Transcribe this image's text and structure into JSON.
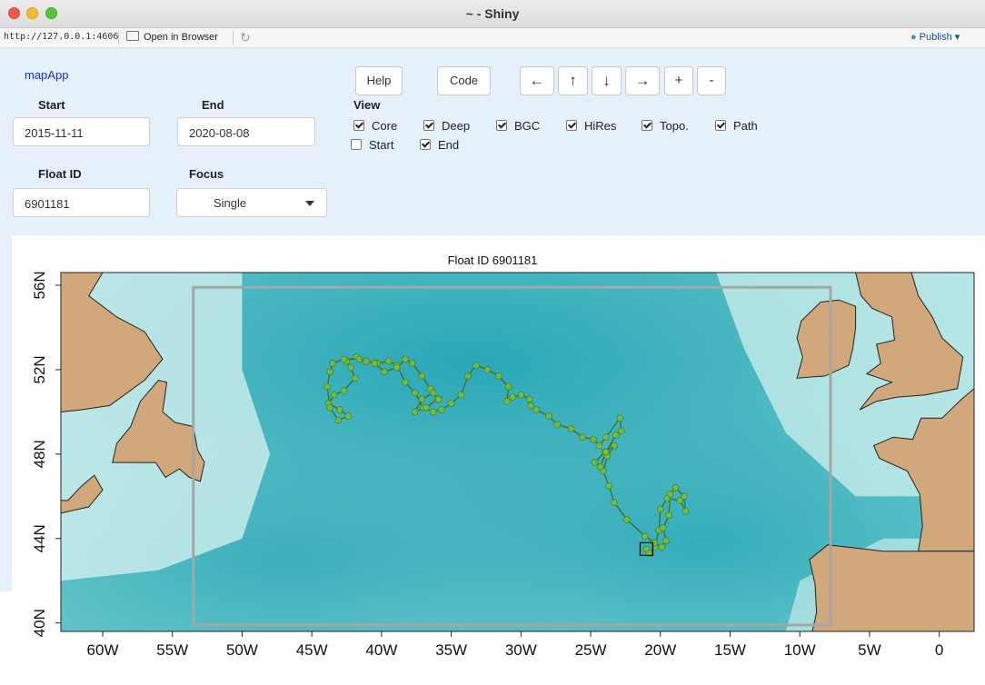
{
  "window": {
    "title": "~ - Shiny"
  },
  "toolbar": {
    "url": "http://127.0.0.1:4606",
    "open_in_browser": "Open in Browser",
    "publish": "Publish"
  },
  "app": {
    "name": "mapApp"
  },
  "form": {
    "start_label": "Start",
    "start_value": "2015-11-11",
    "end_label": "End",
    "end_value": "2020-08-08",
    "float_id_label": "Float ID",
    "float_id_value": "6901181",
    "focus_label": "Focus",
    "focus_value": "Single"
  },
  "buttons": {
    "help": "Help",
    "code": "Code",
    "left": "←",
    "up": "↑",
    "down": "↓",
    "right": "→",
    "zoom_in": "+",
    "zoom_out": "-"
  },
  "view": {
    "label": "View",
    "options": [
      {
        "label": "Core",
        "checked": true
      },
      {
        "label": "Deep",
        "checked": true
      },
      {
        "label": "BGC",
        "checked": true
      },
      {
        "label": "HiRes",
        "checked": true
      },
      {
        "label": "Topo.",
        "checked": true
      },
      {
        "label": "Path",
        "checked": true
      },
      {
        "label": "Start",
        "checked": false
      },
      {
        "label": "End",
        "checked": true
      }
    ]
  },
  "plot": {
    "title": "Float ID 6901181",
    "x_ticks": [
      "60W",
      "55W",
      "50W",
      "45W",
      "40W",
      "35W",
      "30W",
      "25W",
      "20W",
      "15W",
      "10W",
      "5W",
      "0"
    ],
    "y_ticks": [
      "56N",
      "52N",
      "48N",
      "44N",
      "40N"
    ],
    "colors": {
      "ocean_deep": "#3fb0bd",
      "ocean_shallow": "#d9f3f1",
      "land": "#d1a77c",
      "track": "#7cc241",
      "box": "#a6a6a6"
    }
  },
  "chart_data": {
    "type": "scatter",
    "title": "Float ID 6901181",
    "xlabel": "",
    "ylabel": "",
    "xlim": [
      -63,
      2.5
    ],
    "ylim": [
      39.6,
      56.6
    ],
    "x_tick_values": [
      -60,
      -55,
      -50,
      -45,
      -40,
      -35,
      -30,
      -25,
      -20,
      -15,
      -10,
      -5,
      0
    ],
    "y_tick_values": [
      56,
      52,
      48,
      44,
      40
    ],
    "focus_region": {
      "lon": [
        -53.5,
        -7.8
      ],
      "lat": [
        39.9,
        55.9
      ]
    },
    "end_marker": {
      "lon": -21.0,
      "lat": 43.5
    },
    "track": {
      "lon": [
        -21.0,
        -20.8,
        -20.4,
        -20.1,
        -20.0,
        -19.5,
        -18.6,
        -18.2,
        -18.3,
        -18.9,
        -19.3,
        -19.4,
        -19.8,
        -19.6,
        -19.9,
        -20.4,
        -21.1,
        -22.4,
        -23.3,
        -23.7,
        -24.1,
        -23.8,
        -23.3,
        -24.0,
        -24.7,
        -24.3,
        -23.9,
        -23.2,
        -22.8,
        -22.9,
        -23.9,
        -24.4,
        -24.8,
        -25.6,
        -26.4,
        -27.4,
        -28.0,
        -28.9,
        -29.3,
        -29.4,
        -30.0,
        -30.6,
        -31.0,
        -30.9,
        -31.6,
        -32.4,
        -33.2,
        -33.8,
        -34.3,
        -35.0,
        -35.7,
        -36.3,
        -37.0,
        -37.6,
        -38.3,
        -38.9,
        -39.5,
        -40.3,
        -41.1,
        -41.8,
        -42.5,
        -42.2,
        -41.9,
        -42.7,
        -43.4,
        -43.8,
        -43.0,
        -42.4,
        -43.1,
        -43.7,
        -43.9,
        -43.7,
        -43.5,
        -42.7,
        -41.6,
        -40.5,
        -39.8,
        -38.9,
        -38.3,
        -37.8,
        -37.1,
        -36.5,
        -36.0,
        -36.8,
        -37.6,
        -37.1,
        -36.3,
        -35.9
      ],
      "lat": [
        43.5,
        43.3,
        43.6,
        44.4,
        45.4,
        45.9,
        45.8,
        45.3,
        46.0,
        46.4,
        46.1,
        45.1,
        44.5,
        43.9,
        43.6,
        43.8,
        44.1,
        44.9,
        45.7,
        46.5,
        47.2,
        47.9,
        48.4,
        48.1,
        47.6,
        47.4,
        48.1,
        48.9,
        49.1,
        49.7,
        48.8,
        48.4,
        48.7,
        48.8,
        49.2,
        49.4,
        49.8,
        50.1,
        50.3,
        50.6,
        50.8,
        50.7,
        50.5,
        51.2,
        51.7,
        52.0,
        52.2,
        51.7,
        50.8,
        50.4,
        50.1,
        50.0,
        50.2,
        50.9,
        51.4,
        52.2,
        52.4,
        52.3,
        52.4,
        52.6,
        52.4,
        52.1,
        51.6,
        51.0,
        50.8,
        50.4,
        50.1,
        49.8,
        49.6,
        50.2,
        51.2,
        51.9,
        52.3,
        52.5,
        52.5,
        52.3,
        51.9,
        52.1,
        52.5,
        52.3,
        51.7,
        51.1,
        50.6,
        50.2,
        50.0,
        50.6,
        50.9,
        50.6
      ]
    }
  }
}
